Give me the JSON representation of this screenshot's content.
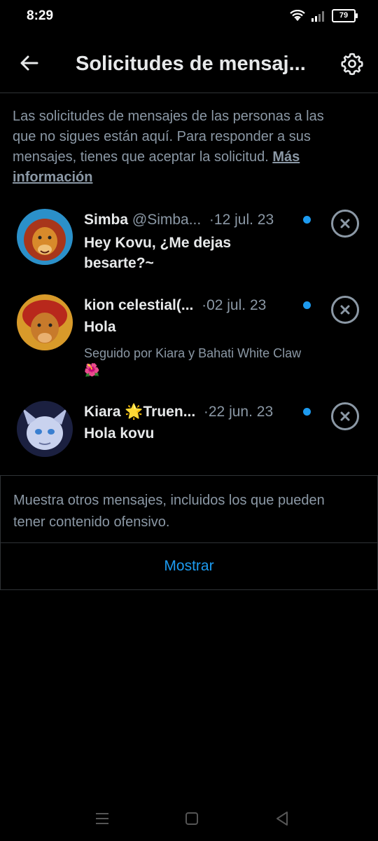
{
  "status": {
    "time": "8:29",
    "battery": "79"
  },
  "header": {
    "title": "Solicitudes de mensaj...",
    "back_icon": "arrow-left-icon",
    "settings_icon": "gear-icon"
  },
  "info": {
    "text": "Las solicitudes de mensajes de las personas a las que no sigues están aquí. Para responder a sus mensajes, tienes que aceptar la solicitud. ",
    "link": "Más información"
  },
  "requests": [
    {
      "name": "Simba",
      "handle": "@Simba...",
      "date": "12 jul. 23",
      "message": "Hey Kovu, ¿Me dejas besarte?~",
      "followed_by": ""
    },
    {
      "name": "kion celestial(...",
      "handle": "",
      "date": "02 jul. 23",
      "message": "Hola",
      "followed_by": "Seguido por Kiara y Bahati White Claw 🌺"
    },
    {
      "name": "Kiara 🌟Truen...",
      "handle": "",
      "date": "22 jun. 23",
      "message": "Hola kovu",
      "followed_by": ""
    }
  ],
  "filtered": {
    "text": "Muestra otros mensajes, incluidos los que pueden tener contenido ofensivo.",
    "button": "Mostrar"
  },
  "colors": {
    "accent": "#1d9bf0",
    "muted": "#8b98a5",
    "background": "#000000"
  }
}
